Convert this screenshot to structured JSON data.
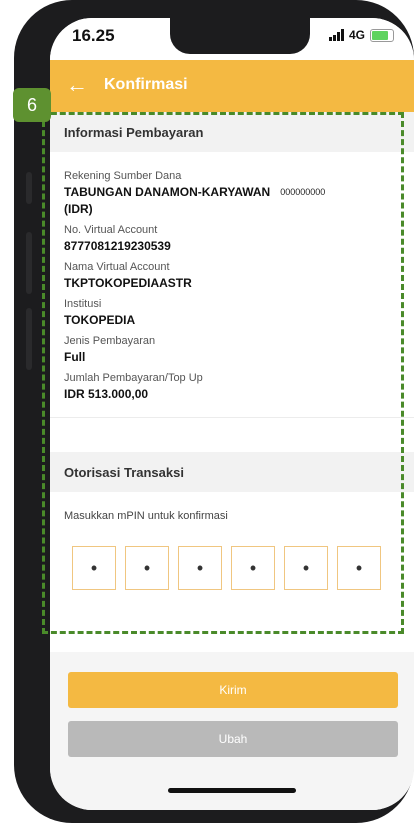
{
  "status_bar": {
    "time": "16.25",
    "network": "4G",
    "battery_icon": "battery-charging-icon"
  },
  "header": {
    "title": "Konfirmasi",
    "back_icon": "arrow-left-icon"
  },
  "annotation": {
    "badge": "6"
  },
  "payment_info": {
    "section_title": "Informasi Pembayaran",
    "source_account_label": "Rekening Sumber Dana",
    "source_account_name": "TABUNGAN DANAMON-KARYAWAN",
    "source_account_number": "000000000",
    "source_account_currency": "(IDR)",
    "va_number_label": "No. Virtual Account",
    "va_number": "8777081219230539",
    "va_name_label": "Nama Virtual Account",
    "va_name": "TKPTOKOPEDIAASTR",
    "institution_label": "Institusi",
    "institution": "TOKOPEDIA",
    "payment_type_label": "Jenis Pembayaran",
    "payment_type": "Full",
    "amount_label": "Jumlah Pembayaran/Top Up",
    "amount": "IDR 513.000,00"
  },
  "authorization": {
    "section_title": "Otorisasi Transaksi",
    "mpin_prompt": "Masukkan mPIN untuk konfirmasi",
    "pin_digits": [
      "•",
      "•",
      "•",
      "•",
      "•",
      "•"
    ]
  },
  "actions": {
    "submit_label": "Kirim",
    "change_label": "Ubah"
  },
  "colors": {
    "accent": "#f4b942",
    "annotation_green": "#4a8a2a",
    "disabled_button": "#b9b9b9"
  }
}
